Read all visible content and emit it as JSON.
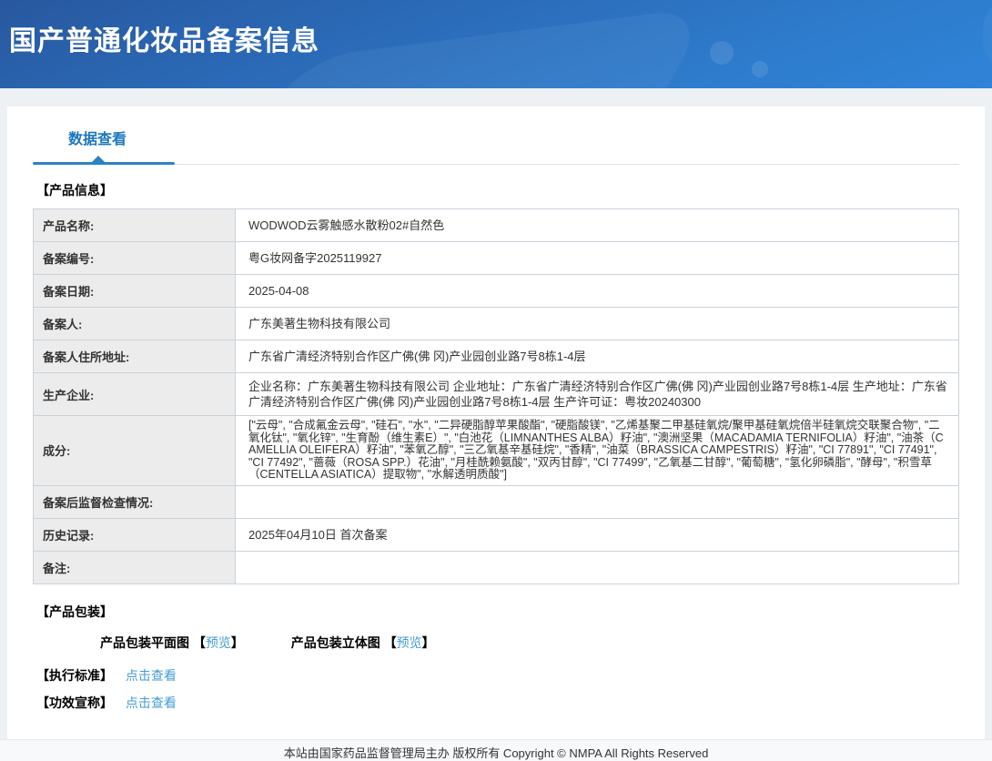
{
  "header": {
    "title": "国产普通化妆品备案信息"
  },
  "tabs": {
    "data_view": "数据查看"
  },
  "sections": {
    "product_info_title": "【产品信息】",
    "product_packaging_title": "【产品包装】",
    "execution_standard_title": "【执行标准】",
    "efficacy_claim_title": "【功效宣称】"
  },
  "product_table": {
    "rows": [
      {
        "label": "产品名称:",
        "value": "WODWOD云雾触感水散粉02#自然色"
      },
      {
        "label": "备案编号:",
        "value": "粤G妆网备字2025119927"
      },
      {
        "label": "备案日期:",
        "value": "2025-04-08"
      },
      {
        "label": "备案人:",
        "value": "广东美著生物科技有限公司"
      },
      {
        "label": "备案人住所地址:",
        "value": "广东省广清经济特别合作区广佛(佛 冈)产业园创业路7号8栋1-4层"
      },
      {
        "label": "生产企业:",
        "value": "企业名称：广东美著生物科技有限公司 企业地址：广东省广清经济特别合作区广佛(佛 冈)产业园创业路7号8栋1-4层 生产地址：广东省广清经济特别合作区广佛(佛 冈)产业园创业路7号8栋1-4层 生产许可证：粤妆20240300"
      },
      {
        "label": "成分:",
        "value": "[\"云母\", \"合成氟金云母\", \"硅石\", \"水\", \"二异硬脂醇苹果酸酯\", \"硬脂酸镁\", \"乙烯基聚二甲基硅氧烷/聚甲基硅氧烷倍半硅氧烷交联聚合物\", \"二氧化钛\", \"氧化锌\", \"生育酚（维生素E）\", \"白池花（LIMNANTHES ALBA）籽油\", \"澳洲坚果（MACADAMIA TERNIFOLIA）籽油\", \"油茶（CAMELLIA OLEIFERA）籽油\", \"苯氧乙醇\", \"三乙氧基辛基硅烷\", \"香精\", \"油菜（BRASSICA CAMPESTRIS）籽油\", \"CI 77891\", \"CI 77491\", \"CI 77492\", \"蔷薇（ROSA SPP.）花油\", \"月桂酰赖氨酸\", \"双丙甘醇\", \"CI 77499\", \"乙氧基二甘醇\", \"葡萄糖\", \"氢化卵磷脂\", \"酵母\", \"积雪草（CENTELLA ASIATICA）提取物\", \"水解透明质酸\"]"
      },
      {
        "label": "备案后监督检查情况:",
        "value": ""
      },
      {
        "label": "历史记录:",
        "value": "2025年04月10日 首次备案"
      },
      {
        "label": "备注:",
        "value": ""
      }
    ]
  },
  "packaging": {
    "flat_label": "产品包装平面图",
    "stereo_label": "产品包装立体图",
    "preview_link": "预览",
    "bracket_open": "【",
    "bracket_close": "】"
  },
  "links": {
    "click_to_view": "点击查看"
  },
  "footer": {
    "text": "本站由国家药品监督管理局主办 版权所有 Copyright © NMPA All Rights Reserved"
  },
  "colors": {
    "header_blue": "#2e7ccd",
    "accent_blue": "#2a82ca",
    "tab_text_blue": "#1d76bd",
    "link_blue": "#449bd6",
    "table_border": "#c9d3dc",
    "label_cell_bg": "#ececec",
    "page_bg": "#edf1f4"
  }
}
